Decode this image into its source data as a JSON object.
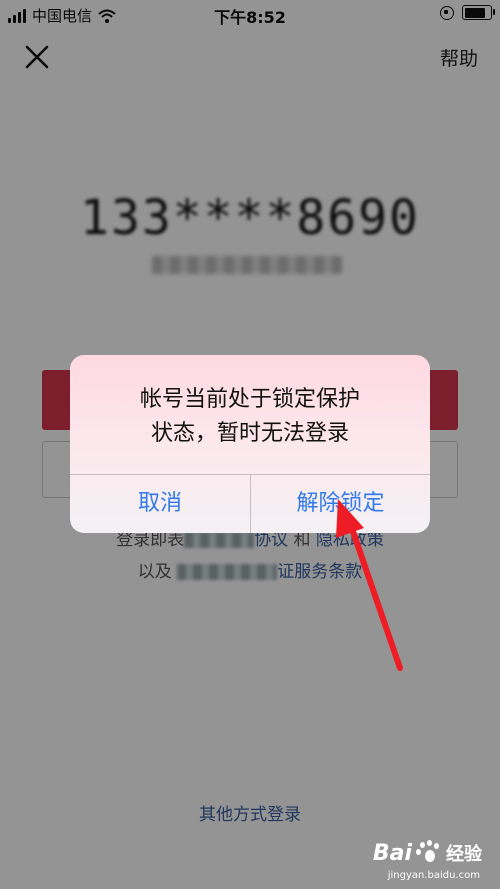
{
  "status_bar": {
    "carrier": "中国电信",
    "time": "下午8:52",
    "battery_level": 0.82
  },
  "header": {
    "close_icon": "close-icon",
    "help_label": "帮助"
  },
  "account": {
    "phone_masked": "133****8690"
  },
  "agreement": {
    "line1_prefix": "登录即表",
    "line1_mid": "协议",
    "line1_and": "和",
    "line1_link": "隐私政策",
    "line2_prefix": "以及",
    "line2_suffix": "证服务条款"
  },
  "other_login_label": "其他方式登录",
  "alert": {
    "message": "帐号当前处于锁定保护\n状态，暂时无法登录",
    "cancel_label": "取消",
    "unlock_label": "解除锁定"
  },
  "watermark": {
    "brand": "Bai",
    "brand_suffix": "经验",
    "url": "jingyan.baidu.com"
  },
  "colors": {
    "primary_red": "#d6344a",
    "alert_button_blue": "#2f79ea",
    "arrow_red": "#ee1c24"
  }
}
